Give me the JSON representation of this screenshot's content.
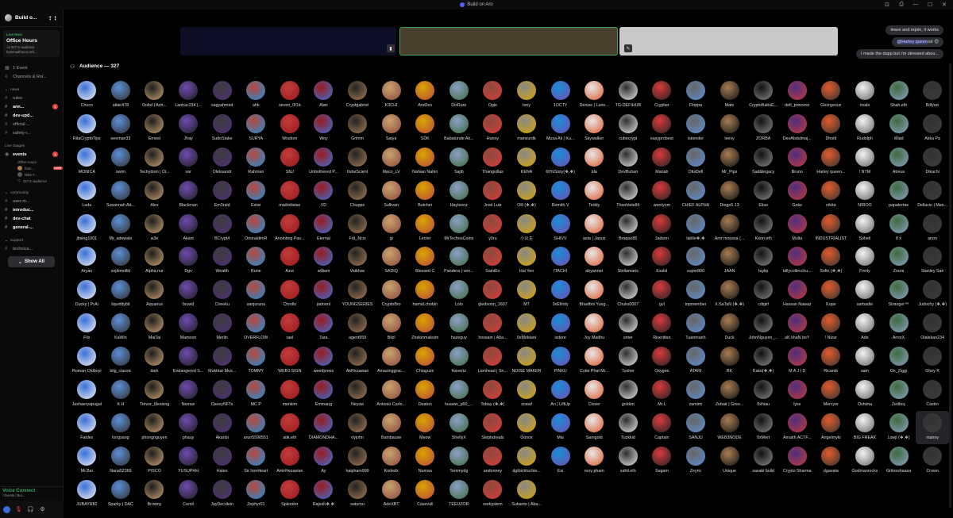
{
  "window": {
    "title": "Build on Aro",
    "controls": [
      "⊡",
      "⎙",
      "—",
      "☐",
      "✕"
    ]
  },
  "sidebar": {
    "server_name": "Build o...",
    "live": {
      "label": "Live Now",
      "title": "Office Hours",
      "audience": "+4 327 in audience",
      "host": "hammadfrance.eth..."
    },
    "items": [
      {
        "label": "1 Event",
        "icon": "calendar-icon"
      },
      {
        "label": "Channels & Rol...",
        "icon": "list-icon"
      }
    ],
    "category_news": "news",
    "channels": [
      {
        "label": "rules",
        "bold": false
      },
      {
        "label": "ann...",
        "bold": true,
        "badge": "1"
      },
      {
        "label": "dev-upd...",
        "bold": true
      },
      {
        "label": "official-...",
        "bold": false
      },
      {
        "label": "safety-r...",
        "bold": false
      }
    ],
    "live_stages": "Live Stages",
    "events": {
      "label": "events",
      "badge": "1",
      "sub": "Office Hours"
    },
    "stage_users": [
      {
        "label": "ham...",
        "live": "LIVE"
      },
      {
        "label": "Mike F..."
      },
      {
        "label": "327 in audience"
      }
    ],
    "category_community": "community",
    "channels2": [
      {
        "label": "user-m...",
        "bold": false
      },
      {
        "label": "introduc...",
        "bold": true
      },
      {
        "label": "dev-chat",
        "bold": true
      },
      {
        "label": "general-...",
        "bold": true
      }
    ],
    "category_support": "support",
    "support_channel": "technica...",
    "show_all": "Show All",
    "voice": {
      "status": "Voice Connect",
      "channel": "/ Events / Bui..."
    }
  },
  "chat": [
    {
      "text": "leave and rejoin, it works"
    },
    {
      "mention": "@Harley queen",
      "text": " sir 😊"
    },
    {
      "text": "I made the dapp but i'm stressed abou..."
    }
  ],
  "audience": {
    "title": "Audience — 327"
  },
  "names": [
    "Choco",
    "altair478",
    "0xAxl | Ach...",
    "Laohac234 |...",
    "sagyahmed",
    "ahk",
    "seven_0f1b",
    "Alan",
    "Cryptgabriel",
    "K3CHI",
    "And3ev",
    "DixRare",
    "Ogie",
    "tony",
    "1OCTY",
    "Denise | Lune...",
    "TG-DEFIHUB",
    "Cryptier",
    "Floppa",
    "Mato",
    "CryptoBabuE...",
    "defi_princess",
    "Georgeous",
    "rivale",
    "Shah.eth",
    "Billyuzi",
    "RitaCryptoTips",
    "eeeman33",
    "Ernest",
    "Jhay",
    "SudoStake",
    "SURYA",
    "Wisdom",
    "Woy",
    "Grimm",
    "Satya",
    "SDK",
    "Babatunde Ak...",
    "Hunny",
    "mansurdk",
    "Musa Ali | Ku...",
    "Skywalker",
    "cubecrypt",
    "easyprobest",
    "iskender",
    "leevy",
    "ZORBA",
    "DevAbdulmaj...",
    "Dhold",
    "Rudolph",
    "Wiad",
    "Akka Pa",
    "MONICA",
    "swim",
    "Techydom | Di...",
    "var",
    "Oleksandr",
    "Rahman",
    "SNJ",
    "Unbothered P...",
    "0xbeScient",
    "Maco_LV",
    "Nahian Nahin",
    "Sajib",
    "Thangvillas",
    "KENA",
    "60%Sixty(❖,❖)",
    "bfa",
    "DevBuhari",
    "Mariah",
    "OtisDefi",
    "Mr_Pips",
    "Sad&legacy",
    "Bruno",
    "Harley queen...",
    "! NTM",
    "Atreus",
    "Dikachi",
    "Luda",
    "Susannah Ad...",
    "Alex",
    "Blackman",
    "Em3rald",
    "Estar",
    "madridistax",
    "VD",
    "Chuppe",
    "Sullivan",
    "Butcher",
    "Hayleenz",
    "José Luiz",
    "Olli (❖,❖)",
    "Remith.V",
    "Teddy",
    "Thanhlele84",
    "wentyom",
    "CHIEF ALPHA",
    "Diogo5.13",
    "Elias",
    "Goke",
    "nikita",
    "NIROO",
    "papatortas",
    "Dellacin | Man...",
    "jbsing1001",
    "Mr_adewale",
    "w3e",
    "Akani",
    "BCrypt4",
    "OnuraldimR",
    "Anointing Pas...",
    "Eternal",
    "Frã_Ncis",
    "gi",
    "Lecter",
    "MrTechnoCoins",
    "y0ru",
    "小公主",
    "SHIVV",
    "asta | Janus",
    "Braquo85",
    "Jadson",
    "lablle❖,❖",
    "Amr moussa (...",
    "Kenn.eth",
    "Mulla",
    "INDUSTRIALIST",
    "Soheil",
    "0 x",
    "anon",
    "Aryan",
    "sojibmollik",
    "Alpha nur",
    "Dgv",
    "Wealth",
    "Rune",
    "Azur",
    "william",
    "Vaibhav",
    "SADIQ",
    "Blessed C",
    "Pandera | ven...",
    "SaintEx",
    "Hai Yen",
    "ITACHI",
    "abyannet",
    "Stellamaris",
    "Esslid",
    "super800",
    "JAAN",
    "tuylip",
    "billycollecchu...",
    "Sofie (❖,❖)",
    "Fredy",
    "Zoura",
    "Stanley San",
    "Ducky | PrAi",
    "liquiditybit",
    "Aquarius",
    "bruvid",
    "Cheeku",
    "sanjurana",
    "Chrollo",
    "jadoonl",
    "YOUNGSERIES",
    "CryptoBro",
    "hamid.chobin",
    "Lolo",
    "gledsonn_1607",
    "MT",
    "0xEfinity",
    "Bhadboi Yung...",
    "Chuks0007",
    "gvl",
    "topmember",
    "X.SaTaN (❖,❖)",
    "cdigirl",
    "Hassan Nawaz",
    "Kupe",
    "sarbadie",
    "Stranger™",
    "Judochy (❖,❖)",
    "Flix",
    "KaWin",
    "MaiTai",
    "Mamoon",
    "Merlin",
    "OVERFLOW",
    "rael",
    "Tara",
    "agent959",
    "Bilzl",
    "Zhekinmaksim",
    "hazeguy",
    "hossain | Aba...",
    "0xMektani",
    "isdore",
    "Joy Madhu",
    "omer",
    "Riverittan",
    "Tuanmanh",
    "Duck",
    "JohnNguyen_...",
    "aK khaN boY",
    "! Nizar",
    "Ade",
    "ArrorX",
    "Olalekan234",
    "Roman Oldboyi",
    "bilg_classic",
    "dark",
    "Endangered S...",
    "Mukhtar Mus...",
    "TOMMY",
    "WEB3.SIGN",
    "weedjones",
    "AkRezaeian",
    "Amazinggrac...",
    "Chiaguze",
    "Havertz",
    "Lionhead | Sn...",
    "NOISE MAKER",
    "PINKU",
    "Cutie Phat Mi...",
    "Tusher",
    "Oxygen",
    "ATARI",
    "BK",
    "Katsi(❖,❖)",
    "M A J I D",
    "Ricardo",
    "sam",
    "Ox_Ziggi",
    "Glory K",
    "Jashaeryapugal",
    "K H",
    "Trevor_blessing",
    "Nemax",
    "DaveyNFTs",
    "MC P",
    "menkim",
    "Emmang",
    "Neyow",
    "Antonio Carlo...",
    "Deaton",
    "huawei_p60_...",
    "Tobay (❖,❖)",
    "zosiaf",
    "An | LiftUp",
    "Clover",
    "golden",
    "Mr.L",
    "zamimi",
    "Zubair | Gree...",
    "0xhiau",
    "lyss",
    "Mercyer",
    "Oshima",
    "Zedboy",
    "Castro",
    "Fatdex",
    "longsang",
    "phongnguyen",
    "phauy",
    "Akanbi",
    "arun5590551",
    "atik.eth",
    "DIAMONDHA...",
    "oyjohn",
    "Bambause",
    "Meow",
    "ShellyX",
    "Stephdreals",
    "0xinox",
    "Mia",
    "Samgold",
    "Tuzkkid",
    "Captain",
    "SANJU",
    "WEB3NODE",
    "0xMert",
    "Amaith ACTF...",
    "Angelmyki",
    "BIG FREAK",
    "Lowji (❖,❖)",
    "manny",
    "Mr.Bai",
    "Nana52369",
    "PISCO",
    "YUSUPHH",
    "Haleo",
    "Sir IronHeart",
    "AmirRezaeian",
    "Ay",
    "haipham999",
    "Kodedx",
    "Numaa",
    "Temmydg",
    "andonney",
    "dgtbicktuchie...",
    "Esi",
    "nory pham",
    "sahil.eth",
    "Sugam",
    "Zeyric",
    "Unique",
    "sasaki build",
    "Crypto Sharma",
    "dgavata",
    "Godmanrocks",
    "Gritosshaasa",
    "Crown",
    "JUBAYR82",
    "Sparky | DAC",
    "Browny",
    "Cemil",
    "JayDeculein",
    "Zephyr01",
    "Splendor",
    "Rajesh❖,❖",
    "saturnu",
    "AdeXBT",
    "Casevall",
    "TEEUZOR",
    "reekystem",
    "Sukanto | Aba..."
  ],
  "avatar_colors": [
    "#3a6fd8",
    "#e6e6e6",
    "#3b3b3b",
    "#a77c53",
    "#222",
    "#f2f2f2",
    "#8a4a3b",
    "#5c8fd6",
    "#2f2f2f",
    "#b9483c",
    "#111",
    "#caa26f",
    "#3d6b3a",
    "#888",
    "#1d1d1d",
    "#d93a3a",
    "#c23b3b",
    "#4f2d7d",
    "#d9a400",
    "#333",
    "#1c8fd8",
    "#6e4bb0",
    "#666",
    "#9a1b1b",
    "#e05a2b",
    "#8aa0c8"
  ],
  "selected_index": 285
}
